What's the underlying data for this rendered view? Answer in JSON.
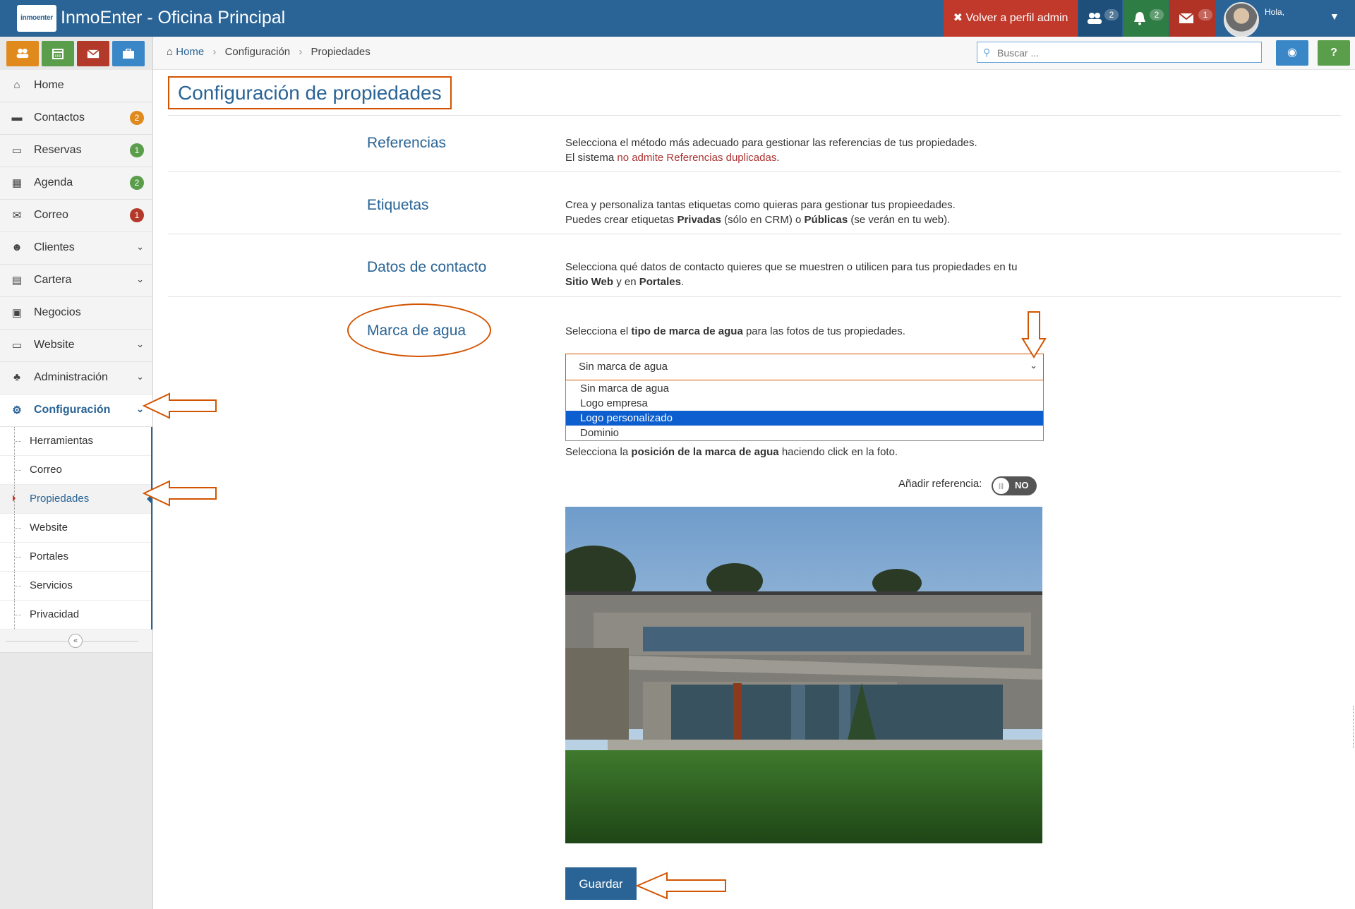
{
  "app": {
    "logo_text": "inmoenter",
    "title": "InmoEnter - Oficina Principal"
  },
  "topbar": {
    "admin_button": "Volver a perfil admin",
    "groups_badge": "2",
    "bell_badge": "2",
    "mail_badge": "1",
    "greeting": "Hola,"
  },
  "breadcrumb": [
    "Home",
    "Configuración",
    "Propiedades"
  ],
  "search": {
    "placeholder": "Buscar ..."
  },
  "sidebar": {
    "items": [
      {
        "label": "Home",
        "icon": "home-icon"
      },
      {
        "label": "Contactos",
        "icon": "comment-icon",
        "badge": "2",
        "badge_color": "#e08a1e"
      },
      {
        "label": "Reservas",
        "icon": "bed-icon",
        "badge": "1",
        "badge_color": "#5a9d4a"
      },
      {
        "label": "Agenda",
        "icon": "calendar-icon",
        "badge": "2",
        "badge_color": "#5a9d4a"
      },
      {
        "label": "Correo",
        "icon": "envelope-icon",
        "badge": "1",
        "badge_color": "#b33a2b"
      },
      {
        "label": "Clientes",
        "icon": "users-icon"
      },
      {
        "label": "Cartera",
        "icon": "briefcase-icon"
      },
      {
        "label": "Negocios",
        "icon": "money-icon"
      },
      {
        "label": "Website",
        "icon": "monitor-icon"
      },
      {
        "label": "Administración",
        "icon": "sitemap-icon"
      },
      {
        "label": "Configuración",
        "icon": "cogs-icon"
      }
    ],
    "submenu": [
      "Herramientas",
      "Correo",
      "Propiedades",
      "Website",
      "Portales",
      "Servicios",
      "Privacidad"
    ]
  },
  "page": {
    "title": "Configuración de propiedades",
    "sections": {
      "referencias": {
        "title": "Referencias",
        "line1": "Selecciona el método más adecuado para gestionar las referencias de tus propiedades.",
        "line2_a": "El sistema ",
        "line2_b": "no admite Referencias duplicadas",
        "line2_c": "."
      },
      "etiquetas": {
        "title": "Etiquetas",
        "line1": "Crea y personaliza tantas etiquetas como quieras para gestionar tus propieedades.",
        "line2_a": "Puedes crear etiquetas ",
        "line2_b": "Privadas",
        "line2_c": " (sólo en CRM) o ",
        "line2_d": "Públicas",
        "line2_e": " (se verán en tu web)."
      },
      "contacto": {
        "title": "Datos de contacto",
        "line1": "Selecciona qué datos de contacto quieres que se muestren o utilicen para tus propiedades en tu",
        "line2_a": "Sitio Web",
        "line2_b": " y en ",
        "line2_c": "Portales",
        "line2_d": "."
      },
      "marca": {
        "title": "Marca de agua",
        "text_a": "Selecciona el ",
        "text_b": "tipo de marca de agua",
        "text_c": " para las fotos de tus propiedades.",
        "select_value": "Sin marca de agua",
        "options": [
          "Sin marca de agua",
          "Logo empresa",
          "Logo personalizado",
          "Dominio"
        ],
        "highlighted_option": "Logo personalizado",
        "pos_a": "Selecciona la ",
        "pos_b": "posición de la marca de agua",
        "pos_c": " haciendo click en la foto.",
        "ref_label": "Añadir referencia:",
        "toggle_state": "NO"
      }
    },
    "save_button": "Guardar"
  },
  "colors": {
    "primary": "#2a6496",
    "annotation": "#d35400",
    "admin_red": "#c0392b"
  }
}
